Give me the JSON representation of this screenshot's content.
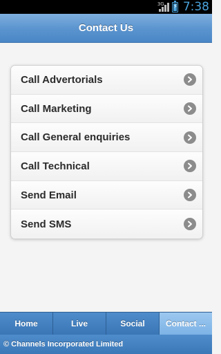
{
  "status_bar": {
    "network": "3G",
    "time": "7:38",
    "accent_color": "#4aa3dd"
  },
  "header": {
    "title": "Contact Us"
  },
  "contact_list": {
    "items": [
      {
        "label": "Call Advertorials",
        "icon": "chevron-right-icon"
      },
      {
        "label": "Call Marketing",
        "icon": "chevron-right-icon"
      },
      {
        "label": "Call General enquiries",
        "icon": "chevron-right-icon"
      },
      {
        "label": "Call Technical",
        "icon": "chevron-right-icon"
      },
      {
        "label": "Send Email",
        "icon": "chevron-right-icon"
      },
      {
        "label": "Send SMS",
        "icon": "chevron-right-icon"
      }
    ]
  },
  "tabs": [
    {
      "label": "Home",
      "active": false
    },
    {
      "label": "Live",
      "active": false
    },
    {
      "label": "Social",
      "active": false
    },
    {
      "label": "Contact ...",
      "active": true
    }
  ],
  "footer": {
    "text": "© Channels Incorporated Limited"
  },
  "colors": {
    "header_blue": "#5c95cf",
    "tab_blue": "#3a76b6",
    "tab_active": "#7db3e6",
    "list_text": "#2b2b2b"
  }
}
